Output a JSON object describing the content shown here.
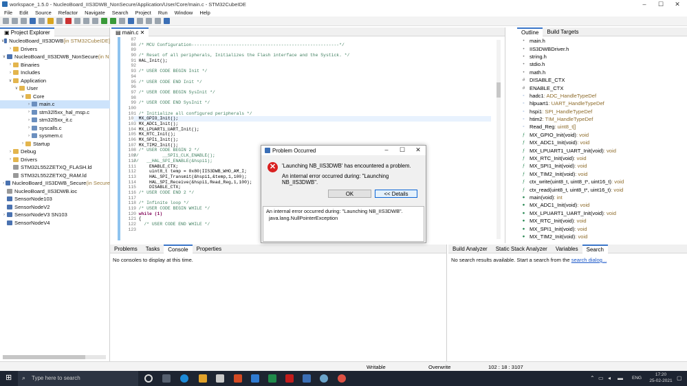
{
  "window": {
    "title": "workspace_1.5.0 - NucleoBoard_IIS3DWB_NonSecure/Application/User/Core/main.c - STM32CubeIDE",
    "minimize": "–",
    "maximize": "☐",
    "close": "✕"
  },
  "menu": [
    "File",
    "Edit",
    "Source",
    "Refactor",
    "Navigate",
    "Search",
    "Project",
    "Run",
    "Window",
    "Help"
  ],
  "explorer": {
    "tab": "Project Explorer",
    "items": [
      {
        "label": "NucleoBoard_IIS3DWB",
        "suffix": " [in STM32CubeIDE]",
        "indent": 0,
        "type": "proj",
        "tw": "∨"
      },
      {
        "label": "Drivers",
        "suffix": "",
        "indent": 1,
        "type": "fold",
        "tw": "›"
      },
      {
        "label": "NucleoBoard_IIS3DWB_NonSecure",
        "suffix": " (in N",
        "indent": 0,
        "type": "proj",
        "tw": "∨"
      },
      {
        "label": "Binaries",
        "suffix": "",
        "indent": 1,
        "type": "fold",
        "tw": "›"
      },
      {
        "label": "Includes",
        "suffix": "",
        "indent": 1,
        "type": "fold",
        "tw": "›"
      },
      {
        "label": "Application",
        "suffix": "",
        "indent": 1,
        "type": "fold",
        "tw": "∨"
      },
      {
        "label": "User",
        "suffix": "",
        "indent": 2,
        "type": "fold",
        "tw": "∨"
      },
      {
        "label": "Core",
        "suffix": "",
        "indent": 3,
        "type": "fold",
        "tw": "∨"
      },
      {
        "label": "main.c",
        "suffix": "",
        "indent": 4,
        "type": "cfile",
        "tw": "›",
        "sel": true
      },
      {
        "label": "stm32l5xx_hal_msp.c",
        "suffix": "",
        "indent": 4,
        "type": "cfile",
        "tw": "›"
      },
      {
        "label": "stm32l5xx_it.c",
        "suffix": "",
        "indent": 4,
        "type": "cfile",
        "tw": "›"
      },
      {
        "label": "syscalls.c",
        "suffix": "",
        "indent": 4,
        "type": "cfile",
        "tw": "›"
      },
      {
        "label": "sysmem.c",
        "suffix": "",
        "indent": 4,
        "type": "cfile",
        "tw": "›"
      },
      {
        "label": "Startup",
        "suffix": "",
        "indent": 3,
        "type": "fold",
        "tw": "›"
      },
      {
        "label": "Debug",
        "suffix": "",
        "indent": 1,
        "type": "fold",
        "tw": "›"
      },
      {
        "label": "Drivers",
        "suffix": "",
        "indent": 1,
        "type": "fold",
        "tw": "›"
      },
      {
        "label": "STM32L552ZETXQ_FLASH.ld",
        "suffix": "",
        "indent": 1,
        "type": "ldfile",
        "tw": ""
      },
      {
        "label": "STM32L552ZETXQ_RAM.ld",
        "suffix": "",
        "indent": 1,
        "type": "ldfile",
        "tw": ""
      },
      {
        "label": "NucleoBoard_IIS3DWB_Secure",
        "suffix": " (in Secure",
        "indent": 0,
        "type": "proj",
        "tw": "›"
      },
      {
        "label": "NucleoBoard_IIS3DWB.ioc",
        "suffix": "",
        "indent": 0,
        "type": "ldfile",
        "tw": ""
      },
      {
        "label": "SensorNode103",
        "suffix": "",
        "indent": 0,
        "type": "proj",
        "tw": ""
      },
      {
        "label": "SensorNodeV2",
        "suffix": "",
        "indent": 0,
        "type": "proj",
        "tw": ""
      },
      {
        "label": "SensorNodeV3 SN103",
        "suffix": "",
        "indent": 0,
        "type": "proj",
        "tw": "›"
      },
      {
        "label": "SensorNodeV4",
        "suffix": "",
        "indent": 0,
        "type": "proj",
        "tw": ""
      }
    ]
  },
  "editor": {
    "tab": "main.c",
    "lines": [
      {
        "n": "87",
        "t": ""
      },
      {
        "n": "88",
        "t": "  /* MCU Configuration--------------------------------------------------------*/",
        "c": "cm"
      },
      {
        "n": "89",
        "t": ""
      },
      {
        "n": "90",
        "t": "  /* Reset of all peripherals, Initializes the Flash interface and the Systick. */",
        "c": "cm"
      },
      {
        "n": "91",
        "t": "  HAL_Init();"
      },
      {
        "n": "92",
        "t": ""
      },
      {
        "n": "93",
        "t": "  /* USER CODE BEGIN Init */",
        "c": "cm"
      },
      {
        "n": "94",
        "t": ""
      },
      {
        "n": "95",
        "t": "  /* USER CODE END Init */",
        "c": "cm"
      },
      {
        "n": "96",
        "t": ""
      },
      {
        "n": "97",
        "t": "  /* USER CODE BEGIN SysInit */",
        "c": "cm"
      },
      {
        "n": "98",
        "t": ""
      },
      {
        "n": "99",
        "t": "  /* USER CODE END SysInit */",
        "c": "cm"
      },
      {
        "n": "100",
        "t": ""
      },
      {
        "n": "101",
        "t": "  /* Initialize all configured peripherals */",
        "c": "cm"
      },
      {
        "n": "102",
        "t": "  MX_GPIO_Init();",
        "hl": true
      },
      {
        "n": "103",
        "t": "  MX_ADC1_Init();"
      },
      {
        "n": "104",
        "t": "  MX_LPUART1_UART_Init();"
      },
      {
        "n": "105",
        "t": "  MX_RTC_Init();"
      },
      {
        "n": "106",
        "t": "  MX_SPI1_Init();"
      },
      {
        "n": "107",
        "t": "  MX_TIM2_Init();"
      },
      {
        "n": "108",
        "t": "  /* USER CODE BEGIN 2 */",
        "c": "cm"
      },
      {
        "n": "109",
        "t": "//         __SPI1_CLK_ENABLE();",
        "c": "cm"
      },
      {
        "n": "110",
        "t": "//   __HAL_SPI_ENABLE(&hspi1);",
        "c": "cm"
      },
      {
        "n": "111",
        "t": "      ENABLE_CTX;"
      },
      {
        "n": "112",
        "t": "      uint8_t temp = 0x80|IIS3DWB_WHO_AM_I;"
      },
      {
        "n": "113",
        "t": "      HAL_SPI_Transmit(&hspi1,&temp,1,100);"
      },
      {
        "n": "114",
        "t": "      HAL_SPI_Receive(&hspi1,Read_Reg,1,100);"
      },
      {
        "n": "115",
        "t": "      DISABLE_CTX;"
      },
      {
        "n": "116",
        "t": "  /* USER CODE END 2 */",
        "c": "cm"
      },
      {
        "n": "117",
        "t": ""
      },
      {
        "n": "118",
        "t": "  /* Infinite loop */",
        "c": "cm"
      },
      {
        "n": "119",
        "t": "  /* USER CODE BEGIN WHILE */",
        "c": "cm"
      },
      {
        "n": "120",
        "t": "  while (1)",
        "c": "kw"
      },
      {
        "n": "121",
        "t": "  {"
      },
      {
        "n": "122",
        "t": "    /* USER CODE END WHILE */",
        "c": "cm"
      },
      {
        "n": "123",
        "t": ""
      }
    ]
  },
  "outline": {
    "tabs": [
      "Outline",
      "Build Targets"
    ],
    "items": [
      {
        "icon": "•",
        "name": "main.h",
        "type": ""
      },
      {
        "icon": "•",
        "name": "IIS3DWBDriver.h",
        "type": ""
      },
      {
        "icon": "•",
        "name": "string.h",
        "type": ""
      },
      {
        "icon": "•",
        "name": "stdio.h",
        "type": ""
      },
      {
        "icon": "•",
        "name": "math.h",
        "type": ""
      },
      {
        "icon": "#",
        "name": "DISABLE_CTX",
        "type": ""
      },
      {
        "icon": "#",
        "name": "ENABLE_CTX",
        "type": ""
      },
      {
        "icon": "◦",
        "name": "hadc1",
        "type": " : ADC_HandleTypeDef"
      },
      {
        "icon": "◦",
        "name": "hlpuart1",
        "type": " : UART_HandleTypeDef"
      },
      {
        "icon": "◦",
        "name": "hspi1",
        "type": " : SPI_HandleTypeDef"
      },
      {
        "icon": "◦",
        "name": "htim2",
        "type": " : TIM_HandleTypeDef"
      },
      {
        "icon": "◦",
        "name": "Read_Reg",
        "type": " : uint8_t[]"
      },
      {
        "icon": "ƒ",
        "name": "MX_GPIO_Init(void)",
        "type": " : void"
      },
      {
        "icon": "ƒ",
        "name": "MX_ADC1_Init(void)",
        "type": " : void"
      },
      {
        "icon": "ƒ",
        "name": "MX_LPUART1_UART_Init(void)",
        "type": " : void"
      },
      {
        "icon": "ƒ",
        "name": "MX_RTC_Init(void)",
        "type": " : void"
      },
      {
        "icon": "ƒ",
        "name": "MX_SPI1_Init(void)",
        "type": " : void"
      },
      {
        "icon": "ƒ",
        "name": "MX_TIM2_Init(void)",
        "type": " : void"
      },
      {
        "icon": "ƒ",
        "name": "ctx_write(uint8_t, uint8_t*, uint16_t)",
        "type": " : void"
      },
      {
        "icon": "ƒ",
        "name": "ctx_read(uint8_t, uint8_t*, uint16_t)",
        "type": " : void"
      },
      {
        "icon": "●",
        "name": "main(void)",
        "type": " : int"
      },
      {
        "icon": "●",
        "name": "MX_ADC1_Init(void)",
        "type": " : void"
      },
      {
        "icon": "●",
        "name": "MX_LPUART1_UART_Init(void)",
        "type": " : void"
      },
      {
        "icon": "●",
        "name": "MX_RTC_Init(void)",
        "type": " : void"
      },
      {
        "icon": "●",
        "name": "MX_SPI1_Init(void)",
        "type": " : void"
      },
      {
        "icon": "●",
        "name": "MX_TIM2_Init(void)",
        "type": " : void"
      }
    ]
  },
  "console": {
    "tabs": [
      "Problems",
      "Tasks",
      "Console",
      "Properties"
    ],
    "message": "No consoles to display at this time."
  },
  "search": {
    "tabs": [
      "Build Analyzer",
      "Static Stack Analyzer",
      "Variables",
      "Search"
    ],
    "message": "No search results available. Start a search from the ",
    "link": "search dialog..."
  },
  "status": {
    "mode": "Writable",
    "insert": "Overwrite",
    "position": "102 : 18 : 3107"
  },
  "taskbar": {
    "search_placeholder": "Type here to search",
    "time": "17:20",
    "date": "25-02-2021",
    "lang": "ENG"
  },
  "dialog": {
    "title": "Problem Occurred",
    "message": "'Launching NB_IIS3DWB' has encountered a problem.",
    "detail": "An internal error occurred during: \"Launching NB_IIS3DWB\".",
    "ok": "OK",
    "details_btn": "<< Details",
    "details_line1": "An internal error occurred during: \"Launching NB_IIS3DWB\".",
    "details_line2": "java.lang.NullPointerException",
    "minimize": "–",
    "maximize": "☐",
    "close": "✕"
  },
  "colors": {
    "accent": "#3874c8",
    "error": "#d92020",
    "taskbar": "#1d2431"
  }
}
